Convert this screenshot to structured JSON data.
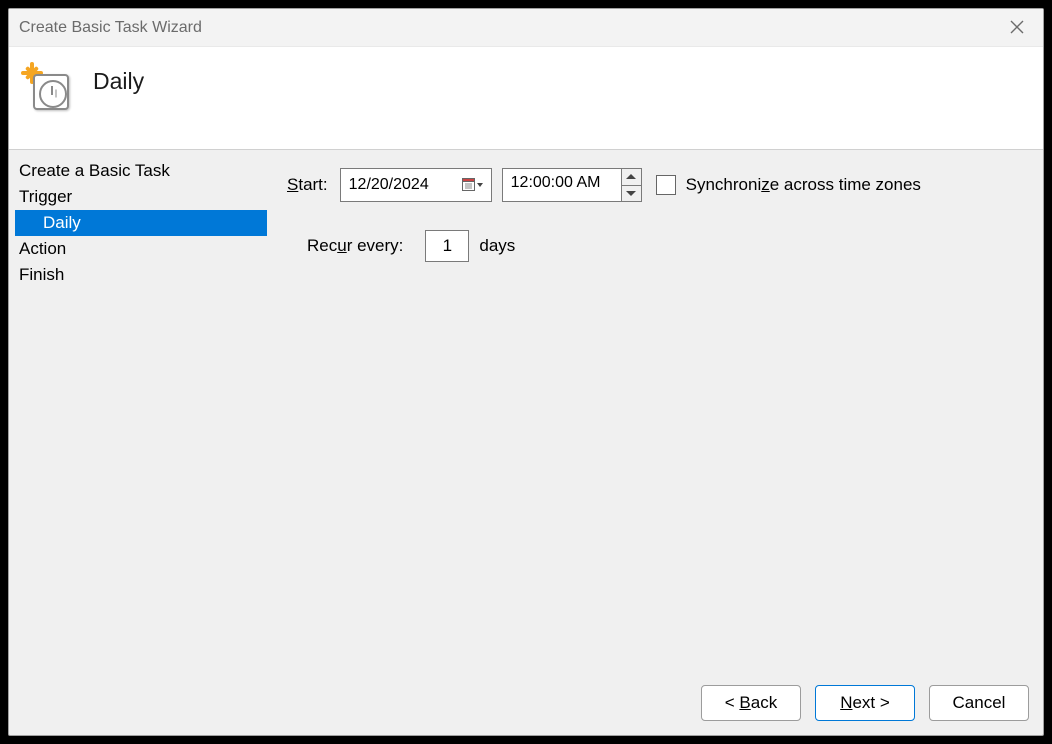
{
  "window": {
    "title": "Create Basic Task Wizard"
  },
  "header": {
    "title": "Daily"
  },
  "sidebar": {
    "items": [
      {
        "label": "Create a Basic Task",
        "indent": false,
        "selected": false
      },
      {
        "label": "Trigger",
        "indent": false,
        "selected": false
      },
      {
        "label": "Daily",
        "indent": true,
        "selected": true
      },
      {
        "label": "Action",
        "indent": false,
        "selected": false
      },
      {
        "label": "Finish",
        "indent": false,
        "selected": false
      }
    ]
  },
  "form": {
    "start_label_prefix": "S",
    "start_label_rest": "tart:",
    "date_value": "12/20/2024",
    "time_value": "12:00:00 AM",
    "sync_label_prefix": "Synchroni",
    "sync_label_access": "z",
    "sync_label_suffix": "e across time zones",
    "sync_checked": false,
    "recur_label_prefix": "Rec",
    "recur_label_access": "u",
    "recur_label_suffix": "r every:",
    "recur_value": "1",
    "recur_unit": "days"
  },
  "buttons": {
    "back_prefix": "< ",
    "back_access": "B",
    "back_suffix": "ack",
    "next_access": "N",
    "next_suffix": "ext >",
    "cancel": "Cancel"
  }
}
